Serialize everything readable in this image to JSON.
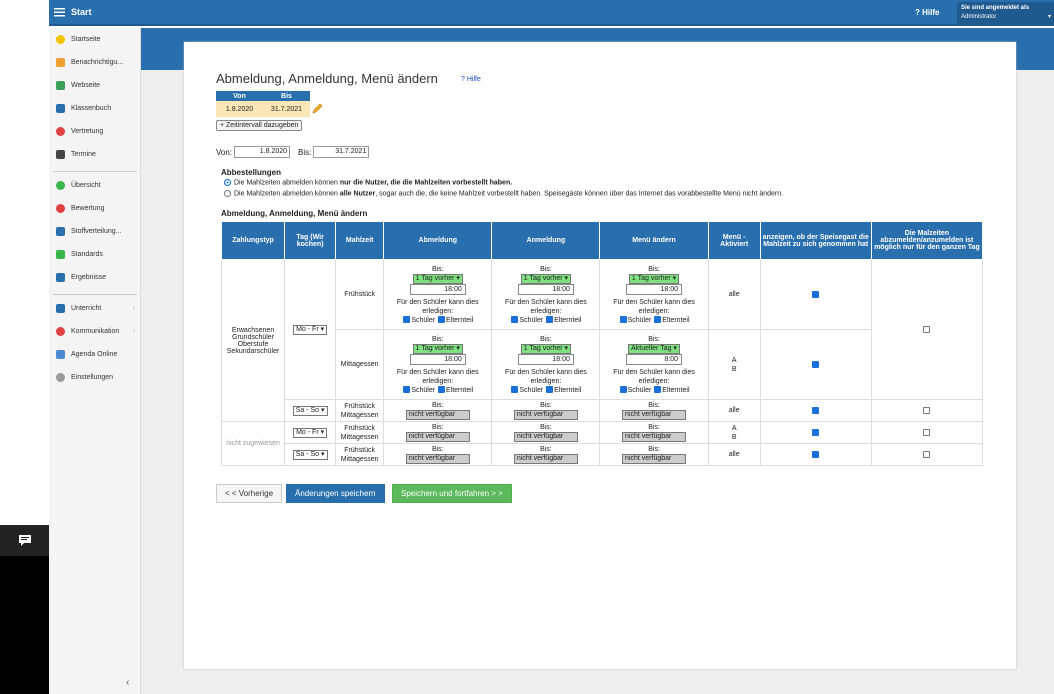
{
  "topbar": {
    "title": "Start",
    "help": "Hilfe",
    "user_caption": "Sie sind angemeldet als",
    "user_role": "Administrator"
  },
  "sidebar": {
    "group1": [
      "Startseite",
      "Benachrichtigu...",
      "Webseite",
      "Klassenbuch",
      "Vertretung",
      "Termine"
    ],
    "group2": [
      "Übersicht",
      "Bewertung",
      "Stoffverteilung...",
      "Standards",
      "Ergebnisse"
    ],
    "group3": [
      "Unterricht",
      "Kommunikation",
      "Agenda Online",
      "Einstellungen"
    ]
  },
  "page": {
    "title": "Abmeldung, Anmeldung, Menü ändern",
    "help_link": "Hilfe",
    "interval": {
      "head_from": "Von",
      "head_to": "Bis",
      "from": "1.8.2020",
      "to": "31.7.2021"
    },
    "add_interval": "+ Zeitintervall dazugeben",
    "from_label": "Von:",
    "from_value": "1.8.2020",
    "to_label": "Bis:",
    "to_value": "31.7.2021",
    "abbestellungen": {
      "title": "Abbestellungen",
      "opt1_a": "Die Mahlzeiten abmelden können ",
      "opt1_b": "nur die Nutzer, die die Mahlzeiten vorbestellt haben.",
      "opt2_a": "Die Mahlzeiten abmelden können ",
      "opt2_b": "alle Nutzer",
      "opt2_c": ", sogar auch die, die keine Mahlzeit vorbestellt haben. Speisegäste können über das Internet das vorabbestellte Menü nicht ändern."
    },
    "section_title": "Abmeldung, Anmeldung, Menü ändern"
  },
  "table": {
    "headers": [
      "Zahlungstyp",
      "Tag (Wir kochen)",
      "Mahlzeit",
      "Abmeldung",
      "Anmeldung",
      "Menü ändern",
      "Menü - Aktiviert",
      "anzeigen, ob der Speisegast die Mahlzeit zu sich genommen hat",
      "Die Malzeiten abzumelden/anzumelden ist möglich nur für den ganzen Tag"
    ],
    "group1_type": "Erwachsenen Grundschüler Oberstufe Sekundarschüler",
    "group2_type": "nicht zugewiesen",
    "bis": "Bis:",
    "hint": "Für den Schüler kann dies erledigen:",
    "schueler": "Schüler",
    "elternteil": "Elternteil",
    "day_mofr": "Mo - Fr",
    "day_saso": "Sa - So",
    "fruehstueck": "Frühstück",
    "mittagessen": "Mittagessen",
    "nicht_verfuegbar": "nicht verfügbar",
    "row1": {
      "ab_sel": "1 Tag vorher",
      "ab_time": "18:00",
      "an_sel": "1 Tag vorher",
      "an_time": "18:00",
      "me_sel": "1 Tag vorher",
      "me_time": "18:00",
      "aktiviert": "alle"
    },
    "row2": {
      "ab_sel": "1 Tag vorher",
      "ab_time": "18:00",
      "an_sel": "1 Tag vorher",
      "an_time": "18:00",
      "me_sel": "Aktueller Tag",
      "me_time": "8:00",
      "aktiviert_a": "A",
      "aktiviert_b": "B"
    },
    "row3": {
      "aktiviert": "alle"
    },
    "row4": {
      "aktiviert_a": "A",
      "aktiviert_b": "B"
    },
    "row5": {
      "aktiviert": "alle"
    }
  },
  "buttons": {
    "prev": "< < Vorherige",
    "save": "Änderungen speichern",
    "save_next": "Speichern und fortfahren > >"
  },
  "colors": {
    "primary": "#2a6fad",
    "green": "#5cb85c",
    "selgreen": "#7ee07e",
    "interval_bg": "#fbe7b5"
  }
}
